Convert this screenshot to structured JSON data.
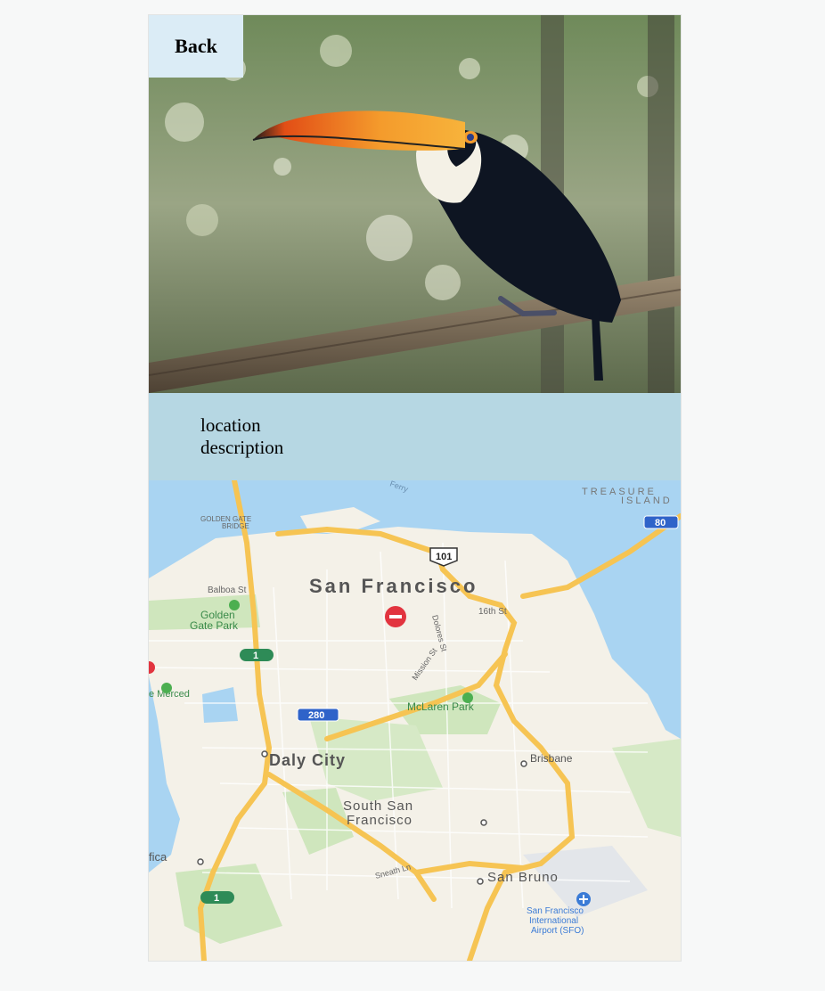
{
  "header": {
    "back_label": "Back"
  },
  "location": {
    "description_label": "location description"
  },
  "map": {
    "labels": {
      "san_francisco": "San Francisco",
      "daly_city": "Daly City",
      "south_sf_line1": "South San",
      "south_sf_line2": "Francisco",
      "san_bruno": "San Bruno",
      "brisbane": "Brisbane",
      "mclaren": "McLaren Park",
      "golden_gate_park_line1": "Golden",
      "golden_gate_park_line2": "Gate Park",
      "golden_gate_bridge_line1": "GOLDEN GATE",
      "golden_gate_bridge_line2": "BRIDGE",
      "treasure_line1": "TREASURE",
      "treasure_line2": "ISLAND",
      "balboa": "Balboa St",
      "sixteenth": "16th St",
      "dolores": "Dolores St",
      "mission": "Mission St",
      "sneath": "Sneath Ln",
      "lake_merced": "e Merced",
      "pacifica": "fica",
      "ferry": "Ferry",
      "sfo_line1": "San Francisco",
      "sfo_line2": "International",
      "sfo_line3": "Airport (SFO)",
      "hwy101": "101",
      "hwy280": "280",
      "hwy80": "80",
      "hwy1a": "1",
      "hwy1b": "1"
    },
    "colors": {
      "water": "#a9d4f2",
      "land": "#f4f1e8",
      "park": "#cfe6bd",
      "highway": "#f6c453",
      "road": "#ffffff"
    }
  }
}
